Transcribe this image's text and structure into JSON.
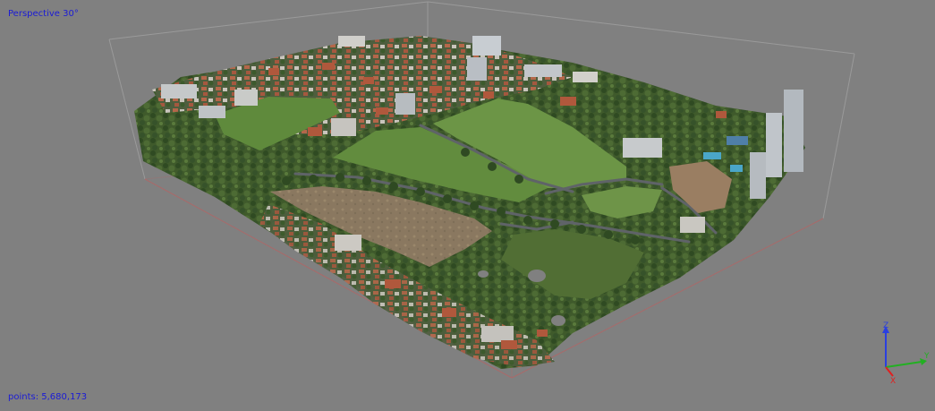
{
  "viewport": {
    "view_label": "Perspective 30°",
    "point_count_label": "points: 5,680,173"
  },
  "axes": {
    "z_label": "Z",
    "y_label": "Y",
    "x_label": "X"
  },
  "colors": {
    "background": "#808080",
    "overlay_text": "#1b1bd6",
    "bbox_grey": "#9a9a9a",
    "bbox_red": "#a86a6a",
    "axis_z": "#2a3fe0",
    "axis_y": "#22b022",
    "axis_x": "#e02020"
  }
}
